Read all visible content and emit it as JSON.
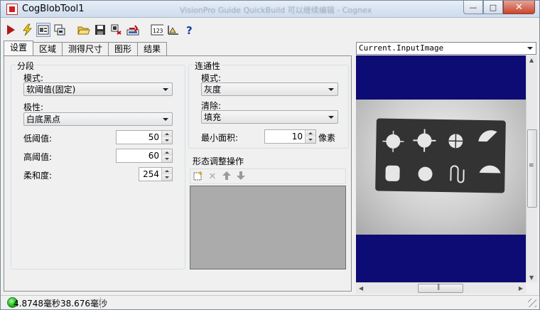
{
  "window": {
    "title": "CogBlobTool1",
    "background_title": "VisionPro Guide QuickBuild 可以继续编辑 - Cognex"
  },
  "toolbar": {
    "icons": [
      "run-icon",
      "electric-icon",
      "toggle-display-icon",
      "floating-window-icon",
      "open-icon",
      "save-icon",
      "reset-icon",
      "load-image-icon",
      "numeric-results-icon",
      "graphics-icon",
      "help-icon"
    ]
  },
  "tabs": [
    "设置",
    "区域",
    "测得尺寸",
    "图形",
    "结果"
  ],
  "segmentation": {
    "title": "分段",
    "mode_label": "模式:",
    "mode_value": "软阈值(固定)",
    "polarity_label": "极性:",
    "polarity_value": "白底黑点",
    "low_threshold_label": "低阈值:",
    "low_threshold_value": "50",
    "high_threshold_label": "高阈值:",
    "high_threshold_value": "60",
    "softness_label": "柔和度:",
    "softness_value": "254"
  },
  "connectivity": {
    "title": "连通性",
    "mode_label": "模式:",
    "mode_value": "灰度",
    "cleanup_label": "清除:",
    "cleanup_value": "填充",
    "min_area_label": "最小面积:",
    "min_area_value": "10",
    "min_area_unit": "像素"
  },
  "morphology": {
    "title": "形态调整操作"
  },
  "image_display": {
    "selected_image": "Current.InputImage"
  },
  "status": {
    "text": "4.8748毫秒38.676毫秒",
    "indicator_color": "#16b816"
  },
  "colors": {
    "display_background": "#0c0c74",
    "morph_list_background": "#ababab"
  }
}
